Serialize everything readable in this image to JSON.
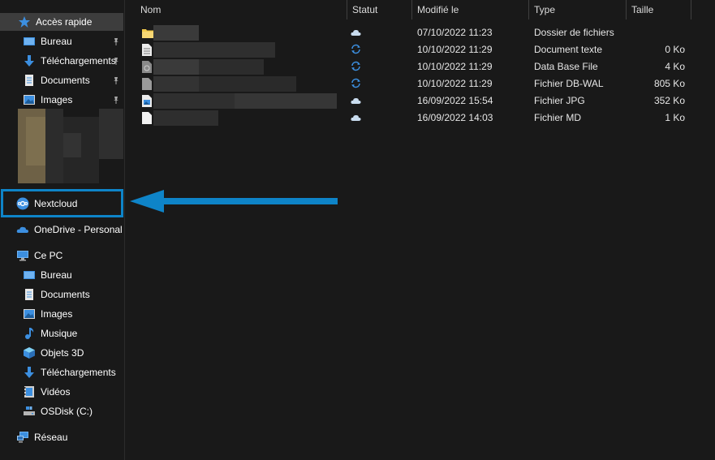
{
  "sidebar": {
    "quick_access": "Accès rapide",
    "quick_items": [
      "Bureau",
      "Téléchargements",
      "Documents",
      "Images"
    ],
    "nextcloud": "Nextcloud",
    "onedrive": "OneDrive - Personal",
    "this_pc": "Ce PC",
    "pc_items": [
      "Bureau",
      "Documents",
      "Images",
      "Musique",
      "Objets 3D",
      "Téléchargements",
      "Vidéos",
      "OSDisk (C:)"
    ],
    "network": "Réseau"
  },
  "columns": {
    "name": "Nom",
    "status": "Statut",
    "modified": "Modifié le",
    "type": "Type",
    "size": "Taille"
  },
  "files": [
    {
      "modified": "07/10/2022 11:23",
      "type": "Dossier de fichiers",
      "size": "",
      "status": "cloud",
      "icon": "folder-icon"
    },
    {
      "modified": "10/10/2022 11:29",
      "type": "Document texte",
      "size": "0 Ko",
      "status": "sync",
      "icon": "text-file-icon"
    },
    {
      "modified": "10/10/2022 11:29",
      "type": "Data Base File",
      "size": "4 Ko",
      "status": "sync",
      "icon": "db-file-icon"
    },
    {
      "modified": "10/10/2022 11:29",
      "type": "Fichier DB-WAL",
      "size": "805 Ko",
      "status": "sync",
      "icon": "generic-file-icon"
    },
    {
      "modified": "16/09/2022 15:54",
      "type": "Fichier JPG",
      "size": "352 Ko",
      "status": "cloud",
      "icon": "image-file-icon"
    },
    {
      "modified": "16/09/2022 14:03",
      "type": "Fichier MD",
      "size": "1 Ko",
      "status": "cloud",
      "icon": "md-file-icon"
    }
  ],
  "colors": {
    "background": "#191919",
    "highlight": "#0e84c8",
    "sync_blue": "#3c8fe0",
    "cloud": "#c9dcef"
  }
}
